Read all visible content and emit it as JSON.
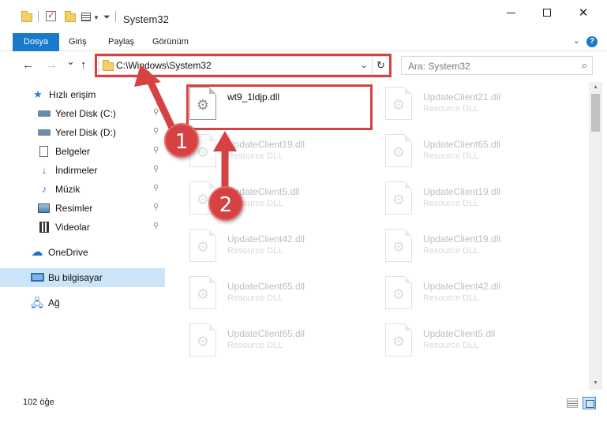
{
  "window": {
    "title": "System32",
    "minimize_glyph": "",
    "maximize_glyph": "",
    "close_glyph": "✕"
  },
  "ribbon": {
    "tabs": [
      "Dosya",
      "Giriş",
      "Paylaş",
      "Görünüm"
    ],
    "active_tab": "Dosya",
    "help_glyph": "?"
  },
  "navigation": {
    "back_glyph": "←",
    "forward_glyph": "→",
    "recent_glyph": "⌄",
    "up_glyph": "↑",
    "address_path": "C:\\Windows\\System32",
    "address_dropdown_glyph": "⌄",
    "refresh_glyph": "↻",
    "search_placeholder": "Ara: System32",
    "search_glyph": "⌕"
  },
  "sidebar": {
    "items": [
      {
        "label": "Hızlı erişim",
        "icon": "star-icon",
        "pinned": false
      },
      {
        "label": "Yerel Disk (C:)",
        "icon": "drive-icon",
        "pinned": true
      },
      {
        "label": "Yerel Disk (D:)",
        "icon": "drive-icon",
        "pinned": true
      },
      {
        "label": "Belgeler",
        "icon": "document-icon",
        "pinned": true
      },
      {
        "label": "İndirmeler",
        "icon": "download-icon",
        "pinned": true
      },
      {
        "label": "Müzik",
        "icon": "music-icon",
        "pinned": true
      },
      {
        "label": "Resimler",
        "icon": "pictures-icon",
        "pinned": true
      },
      {
        "label": "Videolar",
        "icon": "videos-icon",
        "pinned": true
      },
      {
        "label": "OneDrive",
        "icon": "onedrive-icon",
        "pinned": false
      },
      {
        "label": "Bu bilgisayar",
        "icon": "computer-icon",
        "pinned": false,
        "selected": true
      },
      {
        "label": "Ağ",
        "icon": "network-icon",
        "pinned": false
      }
    ],
    "pin_glyph": "📌"
  },
  "files": {
    "left_column": [
      {
        "name": "wt9_1ldjp.dll",
        "type": "",
        "highlighted": true
      },
      {
        "name": "UpdateClient19.dll",
        "type": "Resource DLL"
      },
      {
        "name": "UpdateClient5.dll",
        "type": "Resource DLL"
      },
      {
        "name": "UpdateClient42.dll",
        "type": "Resource DLL"
      },
      {
        "name": "UpdateClient65.dll",
        "type": "Resource DLL"
      },
      {
        "name": "UpdateClient65.dll",
        "type": "Resource DLL"
      }
    ],
    "right_column": [
      {
        "name": "UpdateClient21.dll",
        "type": "Resource DLL"
      },
      {
        "name": "UpdateClient65.dll",
        "type": "Resource DLL"
      },
      {
        "name": "UpdateClient19.dll",
        "type": "Resource DLL"
      },
      {
        "name": "UpdateClient19.dll",
        "type": "Resource DLL"
      },
      {
        "name": "UpdateClient42.dll",
        "type": "Resource DLL"
      },
      {
        "name": "UpdateClient5.dll",
        "type": "Resource DLL"
      }
    ]
  },
  "status": {
    "item_count": "102 öğe"
  },
  "annotations": {
    "step1": "1",
    "step2": "2",
    "color": "#d64242"
  }
}
